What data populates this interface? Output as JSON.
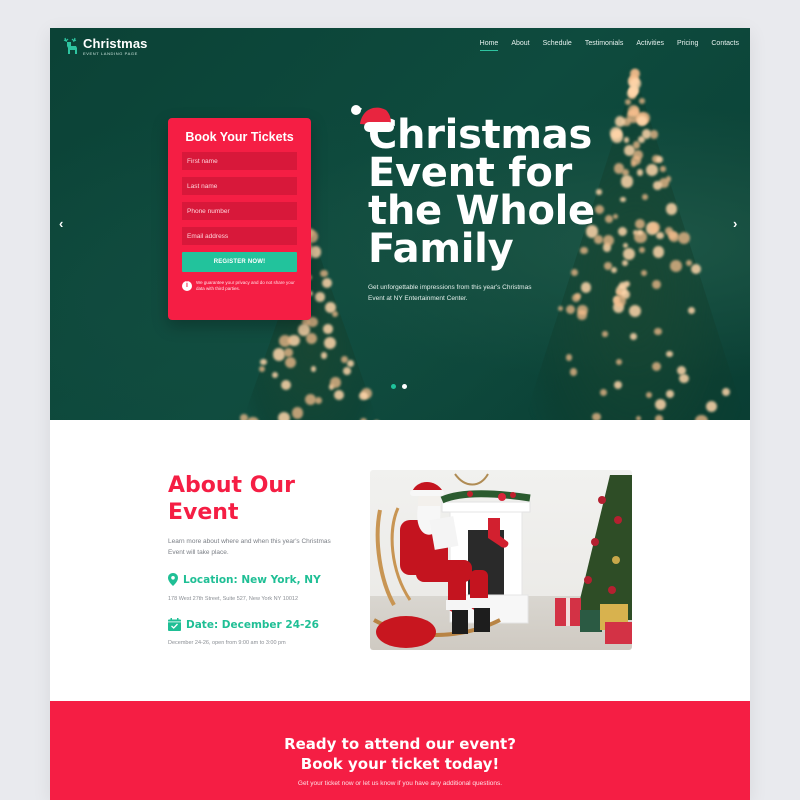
{
  "brand": {
    "title": "Christmas",
    "subtitle": "EVENT LANDING PAGE",
    "logo_icon": "reindeer-icon",
    "accent_green": "#22c39c",
    "accent_red": "#f51e44",
    "hero_bg": "#0b4236"
  },
  "nav": {
    "items": [
      {
        "label": "Home",
        "active": true
      },
      {
        "label": "About",
        "active": false
      },
      {
        "label": "Schedule",
        "active": false
      },
      {
        "label": "Testimonials",
        "active": false
      },
      {
        "label": "Activities",
        "active": false
      },
      {
        "label": "Pricing",
        "active": false
      },
      {
        "label": "Contacts",
        "active": false
      }
    ]
  },
  "hero": {
    "headline": "Christmas Event for the Whole Family",
    "headline_lines": [
      "Christmas",
      "Event for",
      "the Whole",
      "Family"
    ],
    "subtitle": "Get unforgettable impressions from this year's Christmas Event at NY Entertainment Center.",
    "prev_icon": "‹",
    "next_icon": "›",
    "slides_total": 2,
    "slide_active": 1
  },
  "booking_form": {
    "title": "Book Your Tickets",
    "fields": [
      {
        "placeholder": "First name",
        "value": ""
      },
      {
        "placeholder": "Last name",
        "value": ""
      },
      {
        "placeholder": "Phone number",
        "value": ""
      },
      {
        "placeholder": "Email address",
        "value": ""
      }
    ],
    "submit_label": "REGISTER NOW!",
    "privacy_text": "We guarantee your privacy and do not share your data with third parties.",
    "info_icon": "i"
  },
  "about": {
    "title_lines": [
      "About Our",
      "Event"
    ],
    "description": "Learn more about where and when this year's Christmas Event will take place.",
    "location_title": "Location: New York, NY",
    "location_detail": "178 West 27th Street, Suite 527, New York NY 10012",
    "date_title": "Date: December 24-26",
    "date_detail": "December 24-26, open from 9:00 am to 3:00 pm"
  },
  "cta": {
    "title_lines": [
      "Ready to attend our event?",
      "Book your ticket today!"
    ],
    "subtitle": "Get your ticket now or let us know if you have any additional questions."
  }
}
